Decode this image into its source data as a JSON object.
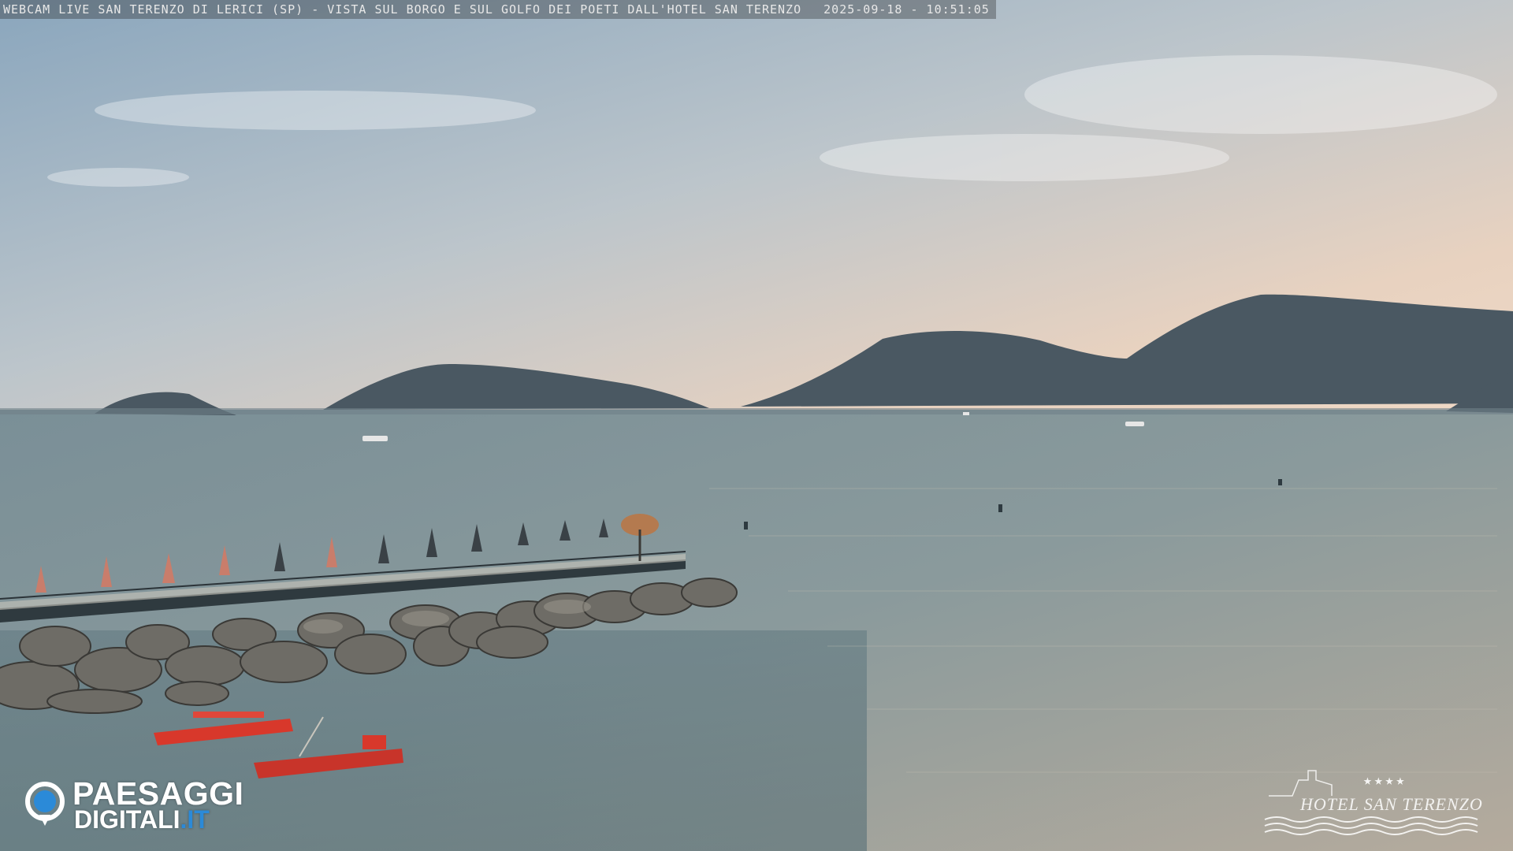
{
  "overlay": {
    "title": "WEBCAM LIVE SAN TERENZO DI LERICI (SP) - VISTA SUL BORGO E SUL GOLFO DEI POETI DALL'HOTEL SAN TERENZO",
    "timestamp": "2025-09-18 - 10:51:05"
  },
  "branding": {
    "left_logo_top": "PAESAGGI",
    "left_logo_bottom": "DIGITALI",
    "left_logo_tld": ".IT",
    "right_logo_name": "HOTEL SAN TERENZO",
    "right_logo_stars": "★★★★"
  },
  "colors": {
    "sky_top": "#8fa9bf",
    "sky_horizon": "#e9cdb8",
    "sea": "#7f9498",
    "hills": "#4a5862",
    "boats": "#d8382b",
    "brand_blue": "#2b8ad8"
  }
}
